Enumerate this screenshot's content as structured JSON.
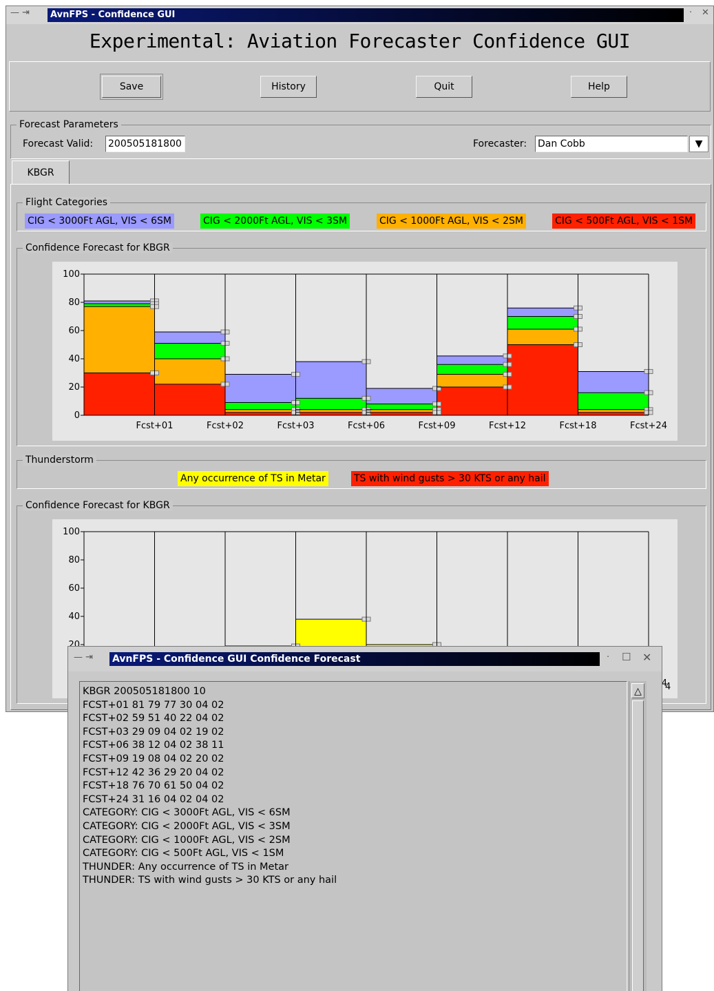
{
  "main_window": {
    "title": "AvnFPS - Confidence GUI",
    "heading": "Experimental: Aviation Forecaster Confidence GUI",
    "buttons": {
      "save": "Save",
      "history": "History",
      "quit": "Quit",
      "help": "Help"
    },
    "params": {
      "group_label": "Forecast Parameters",
      "valid_label": "Forecast Valid:",
      "valid_value": "200505181800",
      "forecaster_label": "Forecaster:",
      "forecaster_value": "Dan Cobb"
    },
    "tab": "KBGR",
    "flight_categories": {
      "group_label": "Flight Categories",
      "items": [
        {
          "label": "CIG < 3000Ft AGL, VIS < 6SM",
          "color": "#9a9aff"
        },
        {
          "label": "CIG < 2000Ft AGL, VIS < 3SM",
          "color": "#00ff00"
        },
        {
          "label": "CIG < 1000Ft AGL, VIS < 2SM",
          "color": "#ffb000"
        },
        {
          "label": "CIG < 500Ft AGL, VIS < 1SM",
          "color": "#ff2000"
        }
      ]
    },
    "confidence_label_1": "Confidence Forecast for KBGR",
    "thunderstorm": {
      "group_label": "Thunderstorm",
      "items": [
        {
          "label": "Any occurrence of TS in Metar",
          "color": "#ffff00"
        },
        {
          "label": "TS with wind gusts > 30 KTS or any hail",
          "color": "#ff2000"
        }
      ]
    },
    "confidence_label_2": "Confidence Forecast for KBGR",
    "partial_tick": "4"
  },
  "chart_data": [
    {
      "type": "bar",
      "title": "Confidence Forecast for KBGR",
      "categories": [
        "Fcst+01",
        "Fcst+02",
        "Fcst+03",
        "Fcst+06",
        "Fcst+09",
        "Fcst+12",
        "Fcst+18",
        "Fcst+24"
      ],
      "ylim": [
        0,
        100
      ],
      "yticks": [
        0,
        20,
        40,
        60,
        80,
        100
      ],
      "series": [
        {
          "name": "CIG < 3000Ft AGL, VIS < 6SM",
          "color": "#9a9aff",
          "values": [
            81,
            59,
            29,
            38,
            19,
            42,
            76,
            31
          ]
        },
        {
          "name": "CIG < 2000Ft AGL, VIS < 3SM",
          "color": "#00ff00",
          "values": [
            79,
            51,
            9,
            12,
            8,
            36,
            70,
            16
          ]
        },
        {
          "name": "CIG < 1000Ft AGL, VIS < 2SM",
          "color": "#ffb000",
          "values": [
            77,
            40,
            4,
            4,
            4,
            29,
            61,
            4
          ]
        },
        {
          "name": "CIG < 500Ft AGL, VIS < 1SM",
          "color": "#ff2000",
          "values": [
            30,
            22,
            2,
            2,
            2,
            20,
            50,
            2
          ]
        }
      ]
    },
    {
      "type": "bar",
      "title": "Confidence Forecast for KBGR",
      "categories": [
        "Fcst+01",
        "Fcst+02",
        "Fcst+03",
        "Fcst+06",
        "Fcst+09",
        "Fcst+12",
        "Fcst+18",
        "Fcst+24"
      ],
      "ylim": [
        0,
        100
      ],
      "yticks": [
        20,
        40,
        60,
        80,
        100
      ],
      "series": [
        {
          "name": "Any occurrence of TS in Metar",
          "color": "#ffff00",
          "values": [
            4,
            4,
            19,
            38,
            20,
            4,
            4,
            4
          ]
        },
        {
          "name": "TS with wind gusts > 30 KTS or any hail",
          "color": "#ff2000",
          "values": [
            2,
            2,
            2,
            11,
            2,
            2,
            2,
            2
          ]
        }
      ]
    }
  ],
  "popup_window": {
    "title": "AvnFPS - Confidence GUI Confidence Forecast",
    "lines": [
      "KBGR 200505181800 10",
      "FCST+01 81 79 77 30 04 02",
      "FCST+02 59 51 40 22 04 02",
      "FCST+03 29 09 04 02 19 02",
      "FCST+06 38 12 04 02 38 11",
      "FCST+09 19 08 04 02 20 02",
      "FCST+12 42 36 29 20 04 02",
      "FCST+18 76 70 61 50 04 02",
      "FCST+24 31 16 04 02 04 02",
      "CATEGORY: CIG < 3000Ft AGL, VIS < 6SM",
      "CATEGORY: CIG < 2000Ft AGL, VIS < 3SM",
      "CATEGORY: CIG < 1000Ft AGL, VIS < 2SM",
      "CATEGORY: CIG < 500Ft AGL, VIS < 1SM",
      "THUNDER: Any occurrence of TS in Metar",
      "THUNDER: TS with wind gusts > 30 KTS or any hail"
    ]
  }
}
